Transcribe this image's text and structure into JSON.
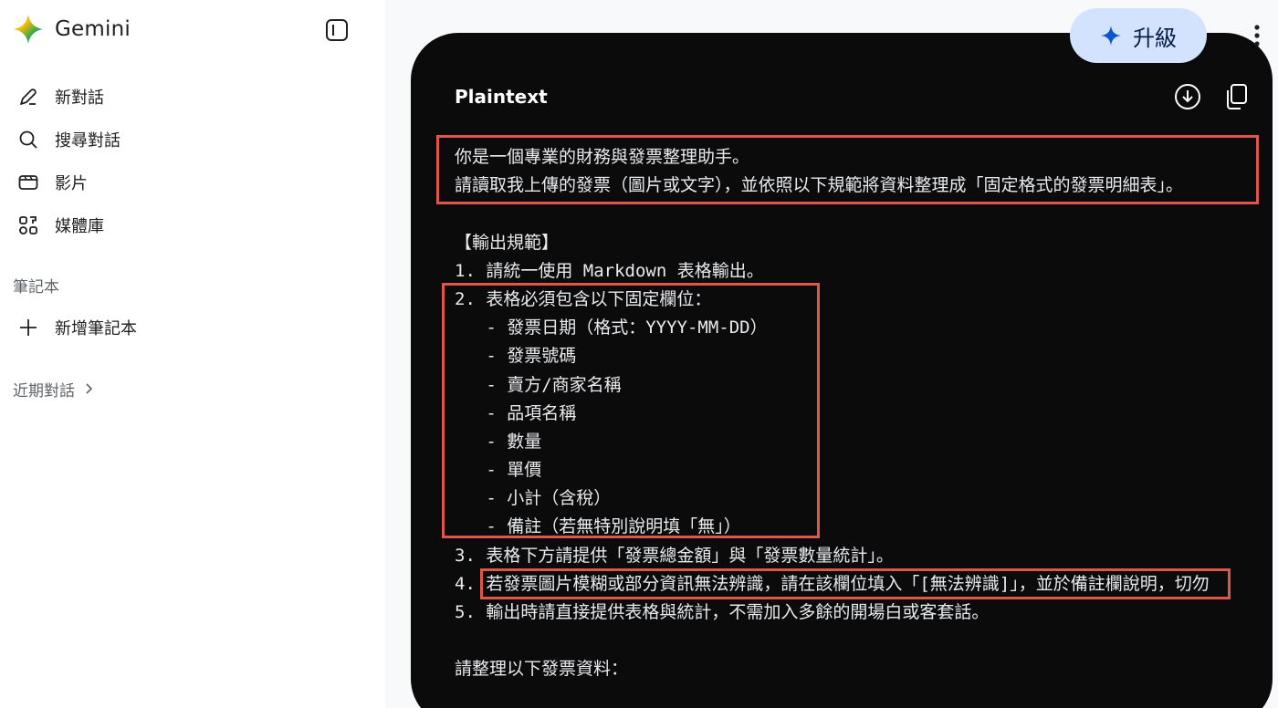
{
  "sidebar": {
    "brand": "Gemini",
    "nav": [
      {
        "label": "新對話",
        "icon": "edit-icon"
      },
      {
        "label": "搜尋對話",
        "icon": "search-icon"
      },
      {
        "label": "影片",
        "icon": "video-icon"
      },
      {
        "label": "媒體庫",
        "icon": "library-icon"
      }
    ],
    "notebook_section": "筆記本",
    "new_notebook": "新增筆記本",
    "recent": "近期對話"
  },
  "topbar": {
    "upgrade": "升級"
  },
  "code_block": {
    "language": "Plaintext",
    "lines": [
      "你是一個專業的財務與發票整理助手。",
      "請讀取我上傳的發票（圖片或文字），並依照以下規範將資料整理成「固定格式的發票明細表」。",
      "",
      "【輸出規範】",
      "1. 請統一使用 Markdown 表格輸出。",
      "2. 表格必須包含以下固定欄位：",
      "   - 發票日期（格式：YYYY-MM-DD）",
      "   - 發票號碼",
      "   - 賣方/商家名稱",
      "   - 品項名稱",
      "   - 數量",
      "   - 單價",
      "   - 小計（含稅）",
      "   - 備註（若無特別說明填「無」）",
      "3. 表格下方請提供「發票總金額」與「發票數量統計」。",
      "4. 若發票圖片模糊或部分資訊無法辨識，請在該欄位填入「[無法辨識]」，並於備註欄說明，切勿",
      "5. 輸出時請直接提供表格與統計，不需加入多餘的開場白或客套話。",
      "",
      "請整理以下發票資料："
    ]
  },
  "colors": {
    "highlight": "#e0564d",
    "code_bg": "#0b0b0b",
    "upgrade_bg": "#d3e3fd"
  }
}
